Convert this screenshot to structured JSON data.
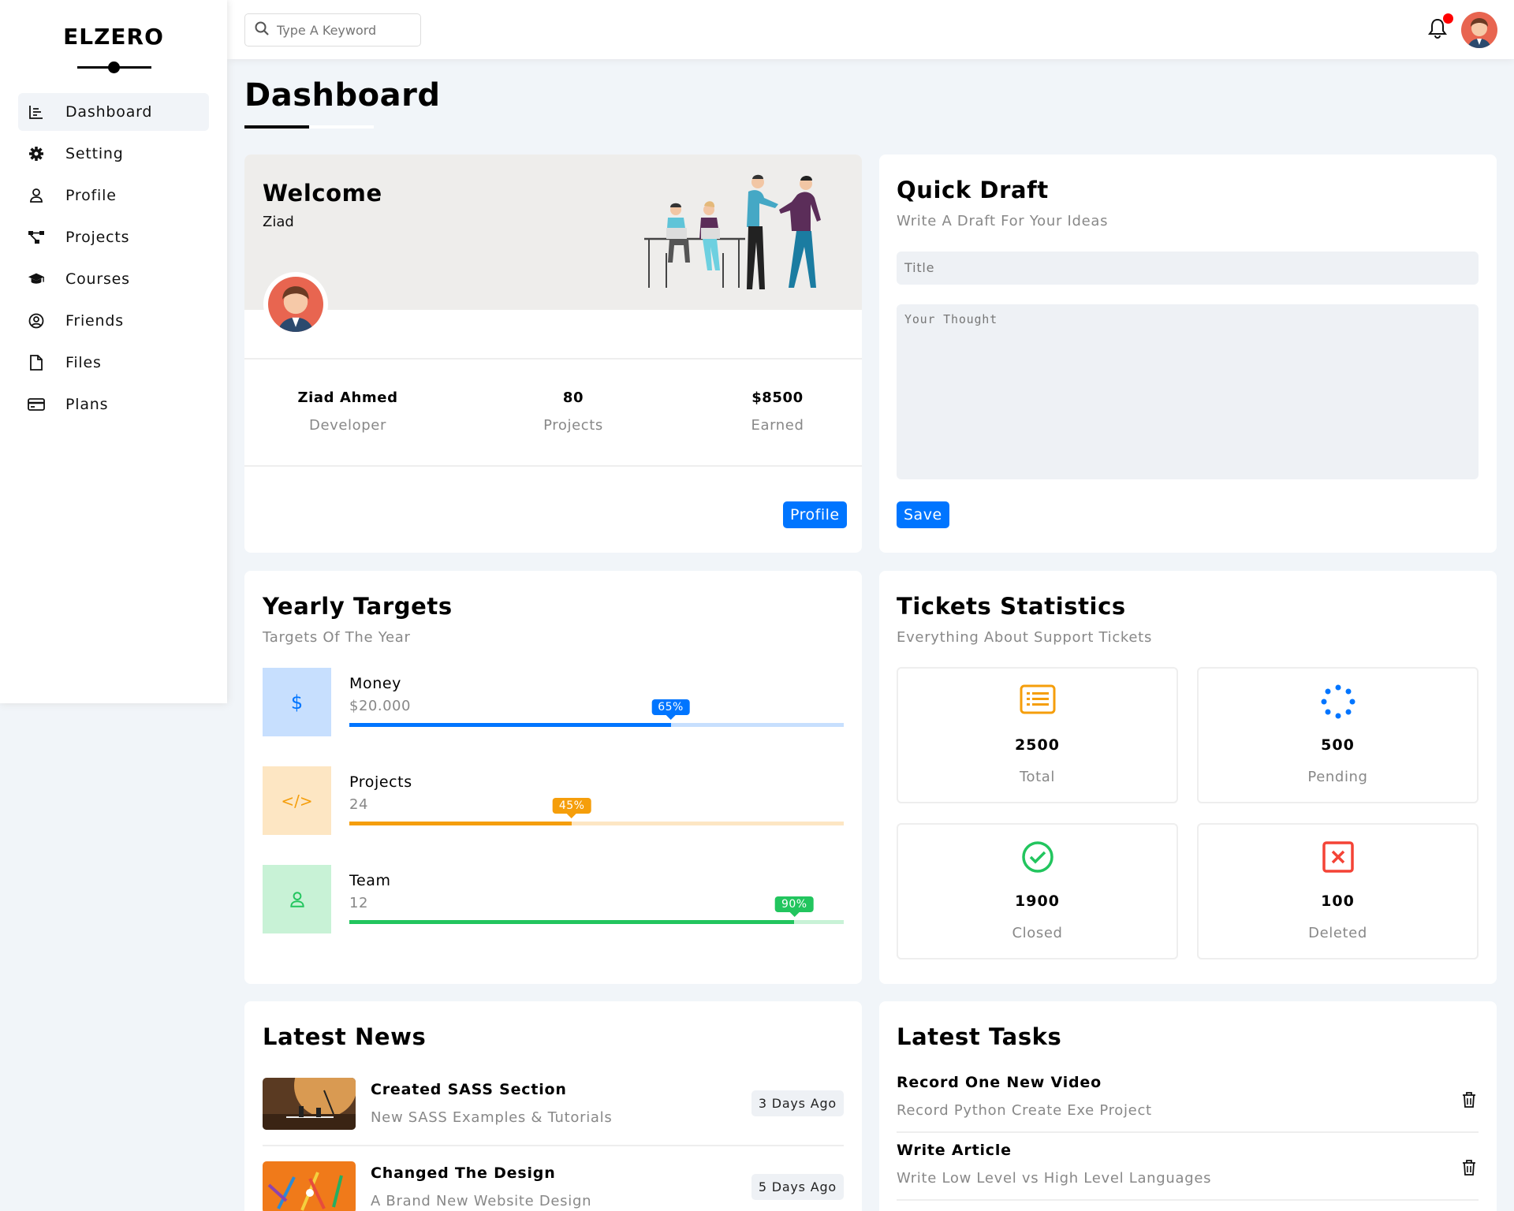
{
  "brand": {
    "name": "ELZERO"
  },
  "sidebar": {
    "items": [
      {
        "label": "Dashboard",
        "icon": "chart-icon",
        "active": true
      },
      {
        "label": "Setting",
        "icon": "gear-icon"
      },
      {
        "label": "Profile",
        "icon": "user-icon"
      },
      {
        "label": "Projects",
        "icon": "diagram-icon"
      },
      {
        "label": "Courses",
        "icon": "graduation-cap-icon"
      },
      {
        "label": "Friends",
        "icon": "user-circle-icon"
      },
      {
        "label": "Files",
        "icon": "file-icon"
      },
      {
        "label": "Plans",
        "icon": "credit-card-icon"
      }
    ]
  },
  "topbar": {
    "search_placeholder": "Type A Keyword",
    "notification_dot_color": "#ff0000"
  },
  "page": {
    "title": "Dashboard"
  },
  "welcome": {
    "title": "Welcome",
    "name": "Ziad",
    "stats": [
      {
        "value": "Ziad Ahmed",
        "label": "Developer"
      },
      {
        "value": "80",
        "label": "Projects"
      },
      {
        "value": "$8500",
        "label": "Earned"
      }
    ],
    "button": "Profile"
  },
  "draft": {
    "title": "Quick Draft",
    "subtitle": "Write A Draft For Your Ideas",
    "title_placeholder": "Title",
    "thought_placeholder": "Your Thought",
    "button": "Save"
  },
  "targets": {
    "title": "Yearly Targets",
    "subtitle": "Targets Of The Year",
    "items": [
      {
        "name": "Money",
        "value": "$20.000",
        "percent": 65,
        "percent_label": "65%",
        "color": "#0075ff",
        "light": "#c7dffe",
        "icon": "dollar-icon"
      },
      {
        "name": "Projects",
        "value": "24",
        "percent": 45,
        "percent_label": "45%",
        "color": "#f59e0b",
        "light": "#fde6c3",
        "icon": "code-icon"
      },
      {
        "name": "Team",
        "value": "12",
        "percent": 90,
        "percent_label": "90%",
        "color": "#22c55e",
        "light": "#c8f2d6",
        "icon": "user-icon"
      }
    ]
  },
  "tickets": {
    "title": "Tickets Statistics",
    "subtitle": "Everything About Support Tickets",
    "items": [
      {
        "value": "2500",
        "label": "Total",
        "icon": "list-icon",
        "color": "#f59e0b"
      },
      {
        "value": "500",
        "label": "Pending",
        "icon": "spinner-icon",
        "color": "#0075ff"
      },
      {
        "value": "1900",
        "label": "Closed",
        "icon": "check-circle-icon",
        "color": "#22c55e"
      },
      {
        "value": "100",
        "label": "Deleted",
        "icon": "x-square-icon",
        "color": "#f44336"
      }
    ]
  },
  "news": {
    "title": "Latest News",
    "items": [
      {
        "title": "Created SASS Section",
        "desc": "New SASS Examples & Tutorials",
        "date": "3 Days Ago"
      },
      {
        "title": "Changed The Design",
        "desc": "A Brand New Website Design",
        "date": "5 Days Ago"
      }
    ]
  },
  "tasks": {
    "title": "Latest Tasks",
    "items": [
      {
        "title": "Record One New Video",
        "desc": "Record Python Create Exe Project"
      },
      {
        "title": "Write Article",
        "desc": "Write Low Level vs High Level Languages"
      }
    ]
  }
}
